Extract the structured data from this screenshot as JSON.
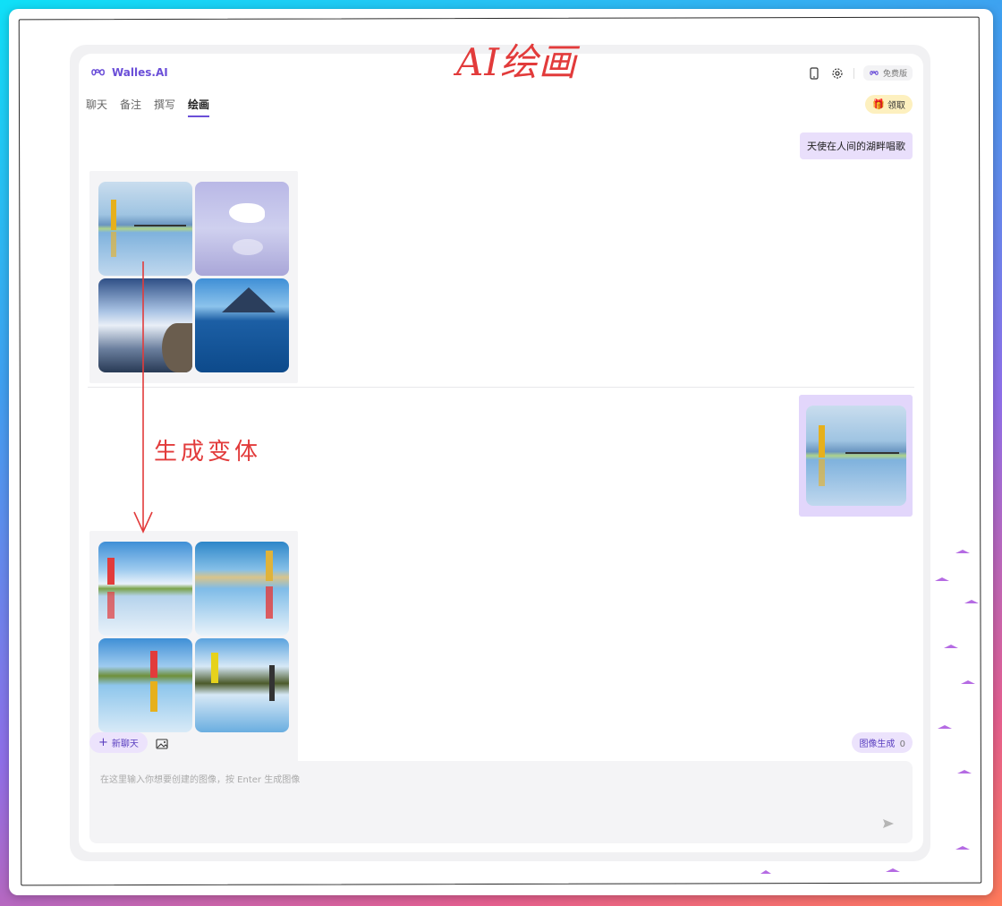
{
  "annotations": {
    "title": "AI绘画",
    "variant_note": "生成变体"
  },
  "header": {
    "logo_text": "Walles.AI",
    "plan_label": "免费版",
    "claim_label": "领取"
  },
  "tabs": [
    {
      "label": "聊天",
      "active": false
    },
    {
      "label": "备注",
      "active": false
    },
    {
      "label": "撰写",
      "active": false
    },
    {
      "label": "绘画",
      "active": true
    }
  ],
  "conversation": {
    "user_prompt": "天使在人间的湖畔唱歌",
    "first_result_images": [
      "lake-woman-reflection",
      "egret-on-water",
      "clouds-mountains-statue",
      "mountain-lake-birds"
    ],
    "uploaded_image": "lake-woman-reflection",
    "variant_images": [
      "variant-1",
      "variant-2",
      "variant-3",
      "variant-4"
    ]
  },
  "bottom_bar": {
    "new_chat_label": "新聊天",
    "gen_count_label": "图像生成",
    "gen_count_value": "0"
  },
  "input": {
    "placeholder": "在这里输入你想要创建的图像，按 Enter 生成图像",
    "value": ""
  },
  "colors": {
    "accent": "#6b4fd8",
    "annotation_red": "#e23b3b",
    "user_bubble": "#e9dffb",
    "claim_bg": "#fdf0bf"
  }
}
